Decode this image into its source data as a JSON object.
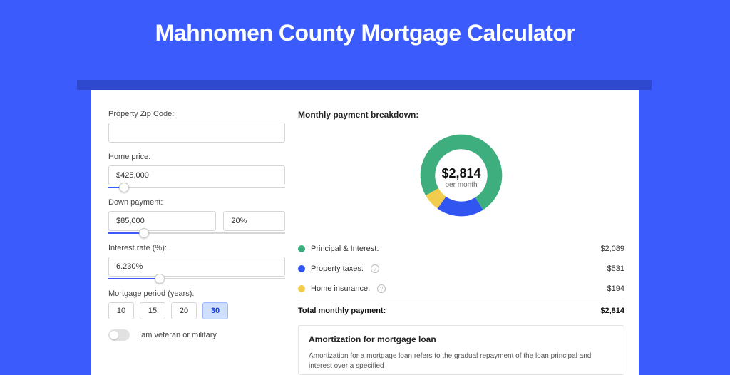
{
  "title": "Mahnomen County Mortgage Calculator",
  "form": {
    "zip": {
      "label": "Property Zip Code:",
      "value": ""
    },
    "price": {
      "label": "Home price:",
      "value": "$425,000",
      "slider_pct": 9
    },
    "down": {
      "label": "Down payment:",
      "amount": "$85,000",
      "percent": "20%",
      "slider_pct": 20
    },
    "rate": {
      "label": "Interest rate (%):",
      "value": "6.230%",
      "slider_pct": 29
    },
    "period": {
      "label": "Mortgage period (years):",
      "options": [
        "10",
        "15",
        "20",
        "30"
      ],
      "selected": "30"
    },
    "veteran": {
      "label": "I am veteran or military"
    }
  },
  "breakdown": {
    "title": "Monthly payment breakdown:",
    "center_amount": "$2,814",
    "center_sub": "per month",
    "items": [
      {
        "label": "Principal & Interest:",
        "value": "$2,089",
        "color": "#3fae7e",
        "info": false
      },
      {
        "label": "Property taxes:",
        "value": "$531",
        "color": "#3055f0",
        "info": true
      },
      {
        "label": "Home insurance:",
        "value": "$194",
        "color": "#f2cc4d",
        "info": true
      }
    ],
    "total_label": "Total monthly payment:",
    "total_value": "$2,814"
  },
  "amort": {
    "title": "Amortization for mortgage loan",
    "text": "Amortization for a mortgage loan refers to the gradual repayment of the loan principal and interest over a specified"
  },
  "chart_data": {
    "type": "pie",
    "title": "Monthly payment breakdown",
    "series": [
      {
        "name": "Principal & Interest",
        "value": 2089,
        "color": "#3fae7e"
      },
      {
        "name": "Property taxes",
        "value": 531,
        "color": "#3055f0"
      },
      {
        "name": "Home insurance",
        "value": 194,
        "color": "#f2cc4d"
      }
    ],
    "total": 2814,
    "center_label": "$2,814 per month"
  }
}
